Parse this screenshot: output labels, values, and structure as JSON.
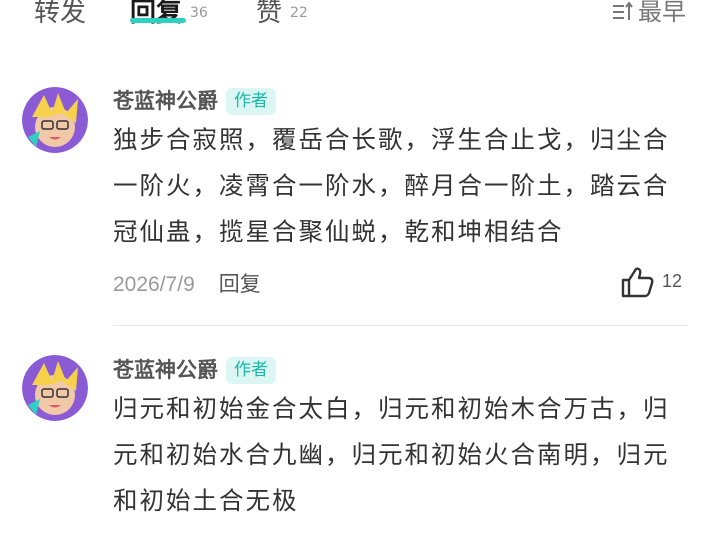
{
  "tabs": [
    {
      "label": "转发",
      "count": ""
    },
    {
      "label": "回复",
      "count": "36"
    },
    {
      "label": "赞",
      "count": "22"
    }
  ],
  "sort_label": "最早",
  "accent_color": "#2dd1c0",
  "comments": [
    {
      "author": "苍蓝神公爵",
      "badge": "作者",
      "text": "独步合寂照，覆岳合长歌，浮生合止戈，归尘合一阶火，凌霄合一阶水，醉月合一阶土，踏云合冠仙蛊，揽星合聚仙蜕，乾和坤相结合",
      "date": "2026/7/9",
      "reply_label": "回复",
      "likes": "12"
    },
    {
      "author": "苍蓝神公爵",
      "badge": "作者",
      "text": "归元和初始金合太白，归元和初始木合万古，归元和初始水合九幽，归元和初始火合南明，归元和初始土合无极"
    }
  ]
}
